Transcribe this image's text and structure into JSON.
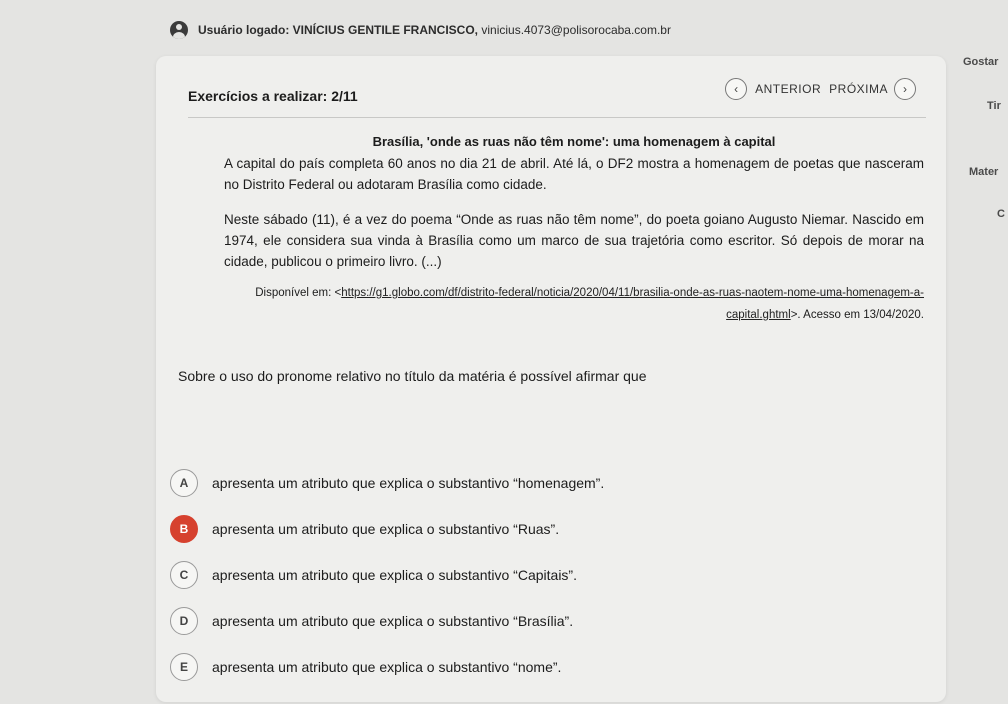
{
  "topbar": {
    "user_label": "Usuário logado: VINÍCIUS GENTILE FRANCISCO,",
    "user_email": "vinicius.4073@polisorocaba.com.br"
  },
  "header": {
    "exercises": "Exercícios a realizar: 2/11",
    "prev_label": "ANTERIOR",
    "next_label": "PRÓXIMA"
  },
  "article": {
    "title": "Brasília, 'onde as ruas não têm nome': uma homenagem à capital",
    "paragraph1": "A capital do país completa 60 anos no dia 21 de abril. Até lá, o DF2 mostra a homenagem de poetas que nasceram no Distrito Federal ou adotaram Brasília como cidade.",
    "paragraph2": "Neste sábado (11), é a vez do poema “Onde as ruas não têm nome”, do poeta goiano Augusto Niemar. Nascido em 1974, ele considera sua vinda à Brasília como um marco de sua trajetória como escritor. Só depois de morar na cidade, publicou o primeiro livro. (...)",
    "source_prefix": "Disponível em: <",
    "source_link": "https://g1.globo.com/df/distrito-federal/noticia/2020/04/11/brasilia-onde-as-ruas-naotem-nome-uma-homenagem-a-capital.ghtml",
    "source_suffix": ">. Acesso em 13/04/2020."
  },
  "question": "Sobre o uso do pronome relativo no título da matéria é possível afirmar que",
  "options": [
    {
      "letter": "A",
      "text": "apresenta um atributo que explica o substantivo “homenagem”."
    },
    {
      "letter": "B",
      "text": "apresenta um atributo que explica o substantivo “Ruas”."
    },
    {
      "letter": "C",
      "text": "apresenta um atributo que explica o substantivo “Capitais”."
    },
    {
      "letter": "D",
      "text": "apresenta um atributo que explica o substantivo “Brasília”."
    },
    {
      "letter": "E",
      "text": "apresenta um atributo que explica o substantivo “nome”."
    }
  ],
  "selected_option": "B",
  "right_column": [
    "Gostar",
    "Tir",
    "Mater",
    "C"
  ],
  "colors": {
    "selected": "#d6412e",
    "background": "#e4e4e2",
    "card": "#efefed"
  }
}
